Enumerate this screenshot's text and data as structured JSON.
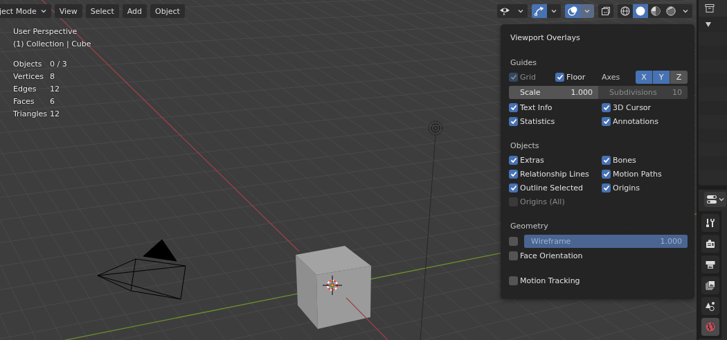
{
  "header": {
    "mode": "ject Mode",
    "menus": [
      "View",
      "Select",
      "Add",
      "Object"
    ],
    "visibility_toggles": [
      {
        "kind": "gizmos",
        "on": true
      },
      {
        "kind": "overlays",
        "on": true
      },
      {
        "kind": "xray",
        "on": false
      }
    ],
    "shading_modes": [
      {
        "kind": "wireframe",
        "selected": false
      },
      {
        "kind": "solid",
        "selected": true
      },
      {
        "kind": "material",
        "selected": false
      },
      {
        "kind": "rendered",
        "selected": false
      }
    ]
  },
  "viewport_info": {
    "view_name": "User Perspective",
    "context": "(1) Collection | Cube",
    "statistics": [
      {
        "label": "Objects",
        "value": "0 / 3"
      },
      {
        "label": "Vertices",
        "value": "8"
      },
      {
        "label": "Edges",
        "value": "12"
      },
      {
        "label": "Faces",
        "value": "6"
      },
      {
        "label": "Triangles",
        "value": "12"
      }
    ]
  },
  "overlays_popover": {
    "open": true,
    "title": "Viewport Overlays",
    "guides": {
      "heading": "Guides",
      "grid": {
        "label": "Grid",
        "checked": true,
        "disabled": true
      },
      "floor": {
        "label": "Floor",
        "checked": true,
        "disabled": false
      },
      "axes": {
        "label": "Axes",
        "buttons": [
          {
            "label": "X",
            "selected": true
          },
          {
            "label": "Y",
            "selected": true
          },
          {
            "label": "Z",
            "selected": false
          }
        ]
      },
      "scale": {
        "label": "Scale",
        "value": "1.000",
        "disabled": false
      },
      "subdivisions": {
        "label": "Subdivisions",
        "value": "10",
        "disabled": true
      },
      "options": [
        {
          "label": "Text Info",
          "checked": true,
          "disabled": false
        },
        {
          "label": "3D Cursor",
          "checked": true,
          "disabled": false
        },
        {
          "label": "Statistics",
          "checked": true,
          "disabled": false
        },
        {
          "label": "Annotations",
          "checked": true,
          "disabled": false
        }
      ]
    },
    "objects": {
      "heading": "Objects",
      "options": [
        {
          "label": "Extras",
          "checked": true,
          "disabled": false
        },
        {
          "label": "Bones",
          "checked": true,
          "disabled": false
        },
        {
          "label": "Relationship Lines",
          "checked": true,
          "disabled": false
        },
        {
          "label": "Motion Paths",
          "checked": true,
          "disabled": false
        },
        {
          "label": "Outline Selected",
          "checked": true,
          "disabled": false
        },
        {
          "label": "Origins",
          "checked": true,
          "disabled": false
        },
        {
          "label": "Origins (All)",
          "checked": false,
          "disabled": true
        }
      ]
    },
    "geometry": {
      "heading": "Geometry",
      "wireframe": {
        "checked": false,
        "label": "Wireframe",
        "value": "1.000",
        "level": 1
      },
      "options": [
        {
          "label": "Face Orientation",
          "checked": false,
          "disabled": false
        }
      ]
    },
    "motion_tracking": {
      "label": "Motion Tracking",
      "checked": false,
      "disabled": false
    }
  },
  "properties_tabs": [
    {
      "kind": "tool",
      "selected": false
    },
    {
      "kind": "render",
      "selected": false
    },
    {
      "kind": "output",
      "selected": false
    },
    {
      "kind": "view_layer",
      "selected": false
    },
    {
      "kind": "scene",
      "selected": false
    },
    {
      "kind": "world",
      "selected": true
    }
  ]
}
